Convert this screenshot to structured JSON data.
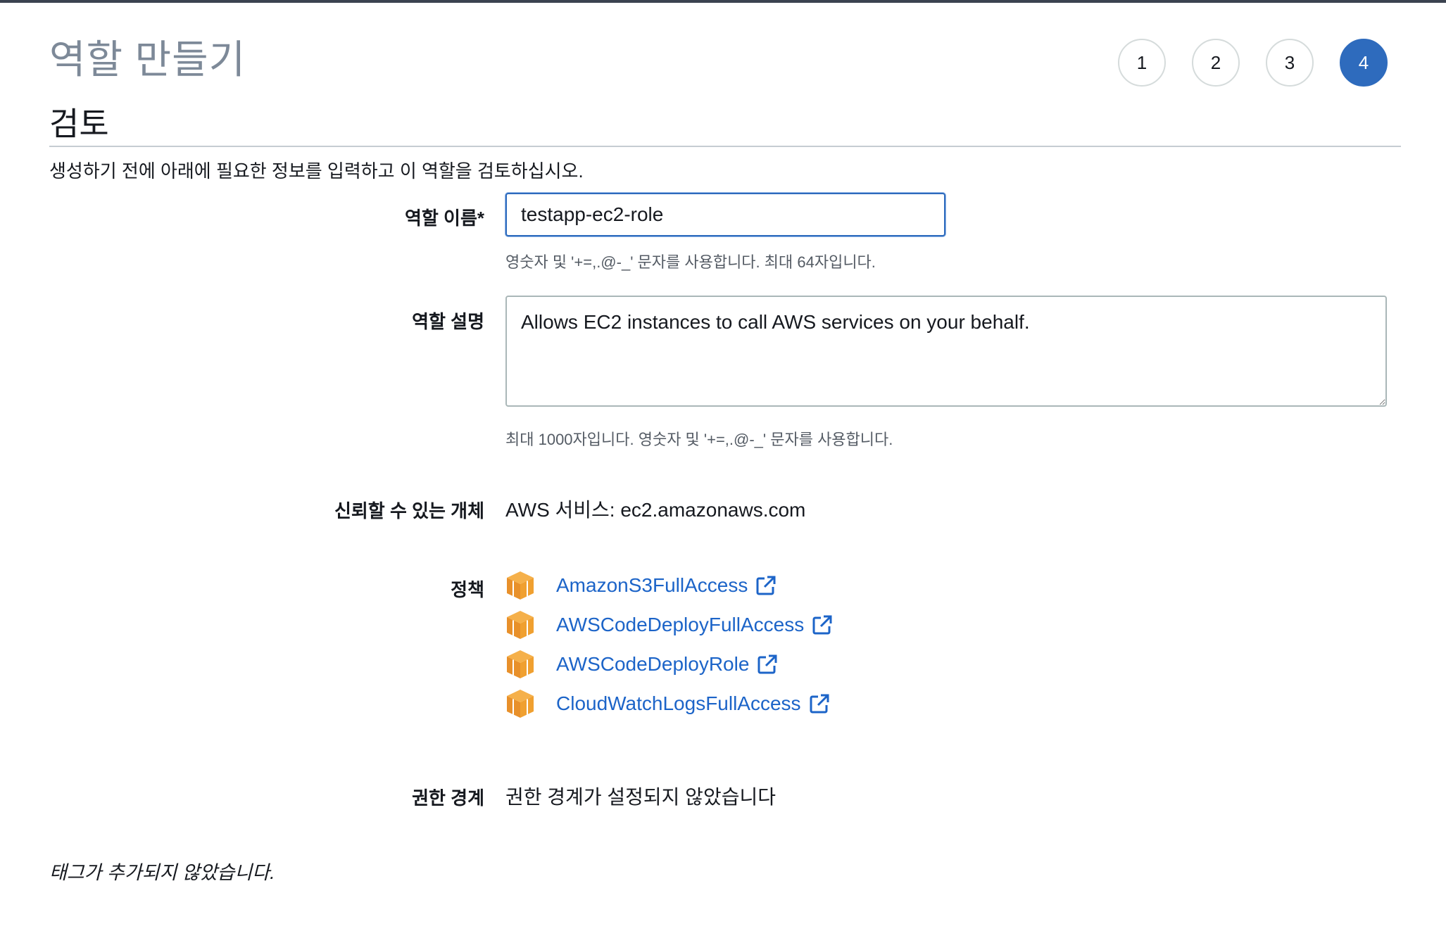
{
  "page_title": "역할 만들기",
  "steps": [
    "1",
    "2",
    "3",
    "4"
  ],
  "active_step": "4",
  "section_title": "검토",
  "intro": "생성하기 전에 아래에 필요한 정보를 입력하고 이 역할을 검토하십시오.",
  "role_name": {
    "label": "역할 이름*",
    "value": "testapp-ec2-role",
    "hint": "영숫자 및 '+=,.@-_' 문자를 사용합니다. 최대 64자입니다."
  },
  "role_description": {
    "label": "역할 설명",
    "value": "Allows EC2 instances to call AWS services on your behalf.",
    "hint": "최대 1000자입니다. 영숫자 및 '+=,.@-_' 문자를 사용합니다."
  },
  "trusted_entities": {
    "label": "신뢰할 수 있는 개체",
    "value": "AWS 서비스: ec2.amazonaws.com"
  },
  "policies": {
    "label": "정책",
    "items": [
      {
        "name": "AmazonS3FullAccess",
        "icon": "policy-box-icon"
      },
      {
        "name": "AWSCodeDeployFullAccess",
        "icon": "policy-box-icon"
      },
      {
        "name": "AWSCodeDeployRole",
        "icon": "policy-box-icon"
      },
      {
        "name": "CloudWatchLogsFullAccess",
        "icon": "policy-box-icon"
      }
    ]
  },
  "permissions_boundary": {
    "label": "권한 경계",
    "value": "권한 경계가 설정되지 않았습니다"
  },
  "tags_note": "태그가 추가되지 않았습니다.",
  "colors": {
    "accent": "#2e6bbd",
    "link": "#1c64c8",
    "policy_icon": "#f0a030"
  }
}
